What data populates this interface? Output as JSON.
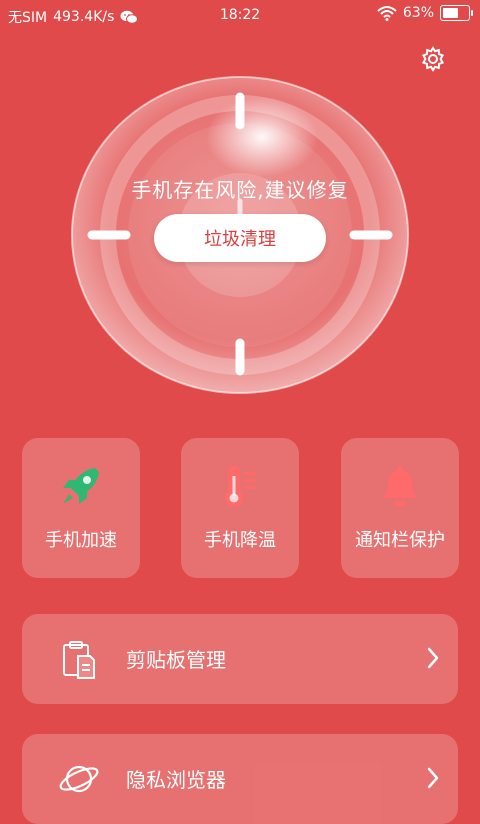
{
  "status_bar": {
    "carrier": "无SIM",
    "speed": "493.4K/s",
    "time": "18:22",
    "battery_percent": "63%",
    "battery_level": 0.63
  },
  "hero": {
    "risk_message": "手机存在风险,建议修复",
    "clean_button": "垃圾清理"
  },
  "tools": [
    {
      "label": "手机加速",
      "icon": "rocket-icon",
      "color": "#2eb872"
    },
    {
      "label": "手机降温",
      "icon": "thermometer-icon",
      "color": "#ff6a6a"
    },
    {
      "label": "通知栏保护",
      "icon": "bell-icon",
      "color": "#ff6a6a"
    }
  ],
  "list": [
    {
      "label": "剪贴板管理",
      "icon": "clipboard-icon"
    },
    {
      "label": "隐私浏览器",
      "icon": "planet-icon"
    }
  ]
}
